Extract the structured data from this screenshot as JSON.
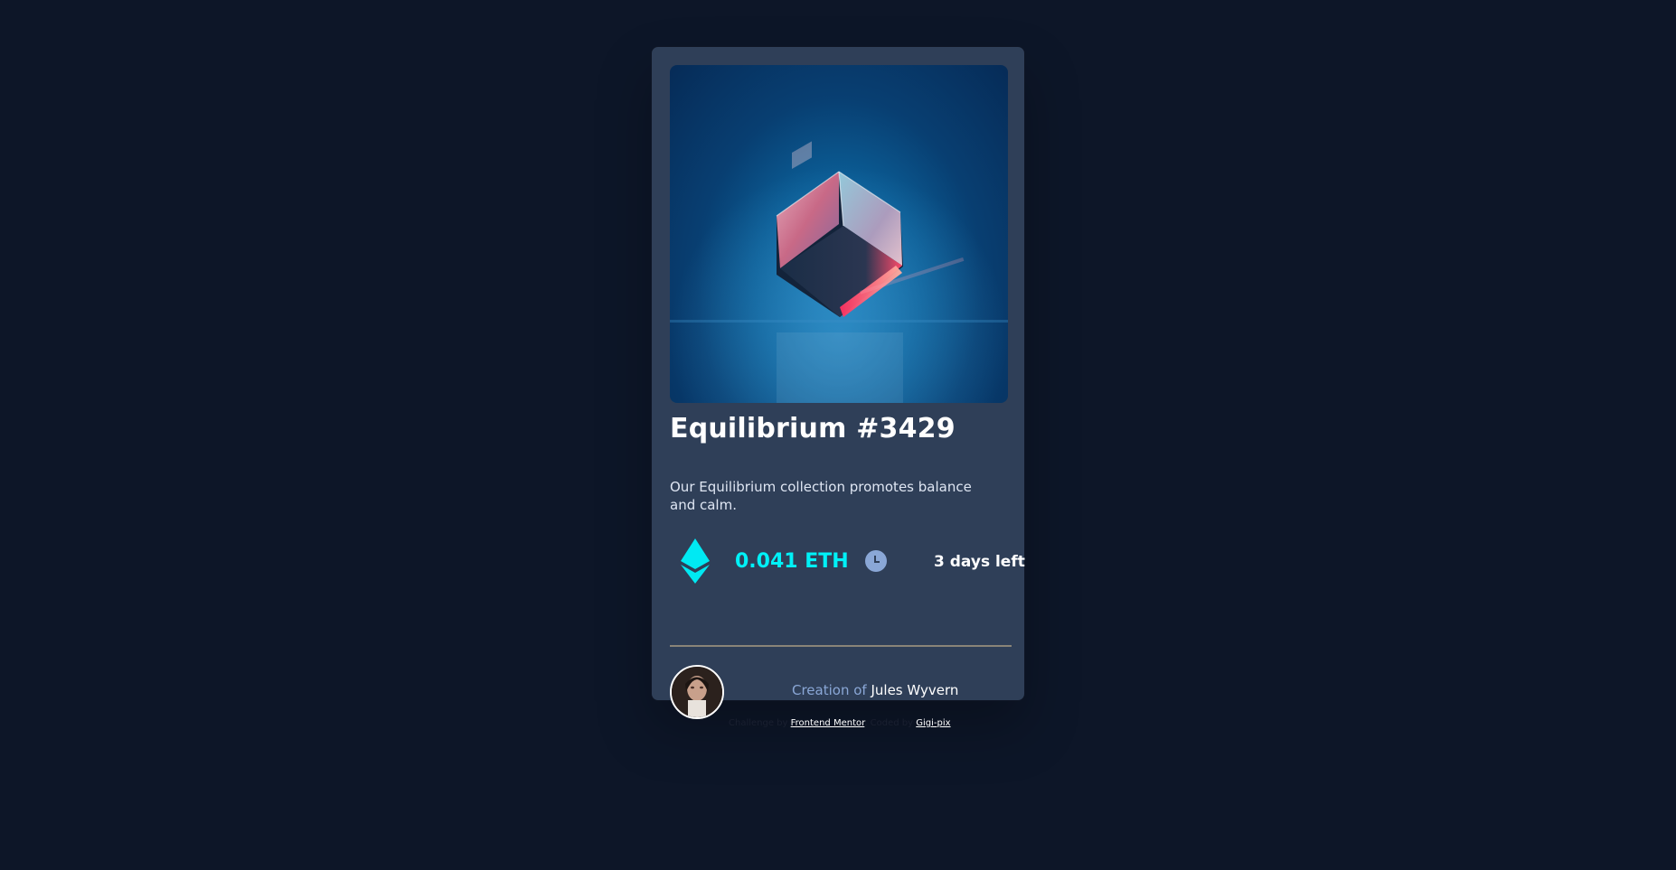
{
  "card": {
    "title": "Equilibrium #3429",
    "description": "Our Equilibrium collection promotes balance and calm.",
    "price": "0.041 ETH",
    "time_left": "3 days left",
    "creator_prefix": "Creation of",
    "creator_name": "Jules Wyvern"
  },
  "icons": {
    "eth": "ethereum-icon",
    "clock": "clock-icon"
  },
  "attribution": {
    "challenge_prefix": "Challenge by",
    "challenge_link": "Frontend Mentor",
    "separator": ". Coded by",
    "author_link": "Gigi-pix"
  },
  "colors": {
    "background": "#0d1628",
    "card": "#2f3f58",
    "accent_cyan": "#00f1f7",
    "muted_blue": "#8aa7d6",
    "white": "#ffffff"
  }
}
